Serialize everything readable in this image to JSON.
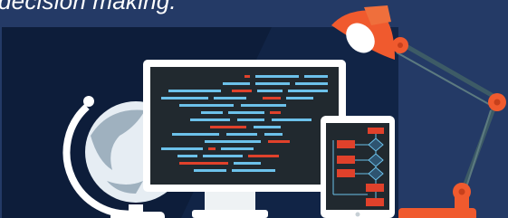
{
  "headline": {
    "text": "decision making."
  },
  "illustration": {
    "objects": [
      "desk-globe",
      "desktop-monitor-with-code",
      "tablet-with-flowchart",
      "desk-lamp"
    ],
    "colors": {
      "background": "#243a66",
      "panel": "#0d1d3a",
      "lamp": "#f05a2e",
      "code_blue": "#6cc1ea",
      "code_red": "#e0412b",
      "screen": "#21292f",
      "device_frame": "#ffffff"
    }
  }
}
